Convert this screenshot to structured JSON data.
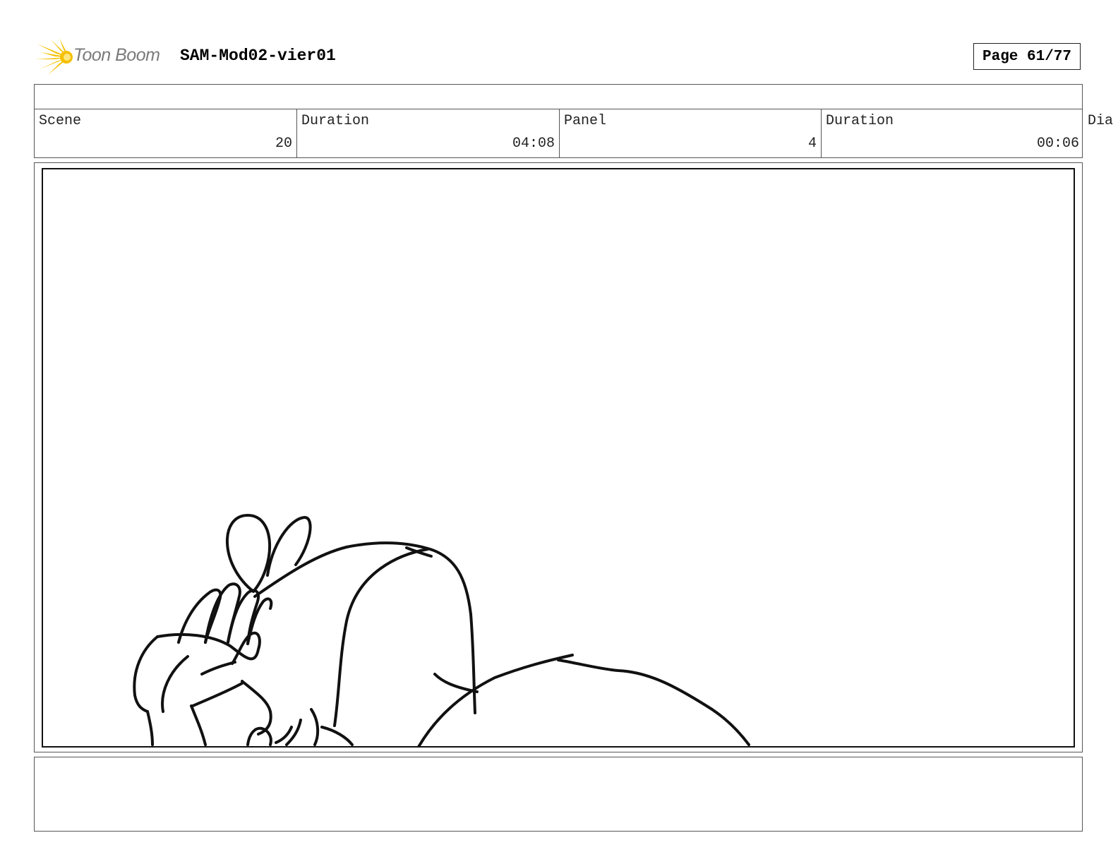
{
  "header": {
    "logo_text": "Toon Boom",
    "project_title": "SAM-Mod02-vier01",
    "page_label": "Page 61/77"
  },
  "info": {
    "scene_label": "Scene",
    "scene_value": "20",
    "scene_duration_label": "Duration",
    "scene_duration_value": "04:08",
    "panel_label": "Panel",
    "panel_value": "4",
    "panel_duration_label": "Duration",
    "panel_duration_value": "00:06",
    "dialogue_label_clipped": "Dia"
  },
  "colors": {
    "logo_burst": "#f5c000",
    "logo_text": "#7a7a7a",
    "border": "#555555",
    "ink": "#111111"
  }
}
